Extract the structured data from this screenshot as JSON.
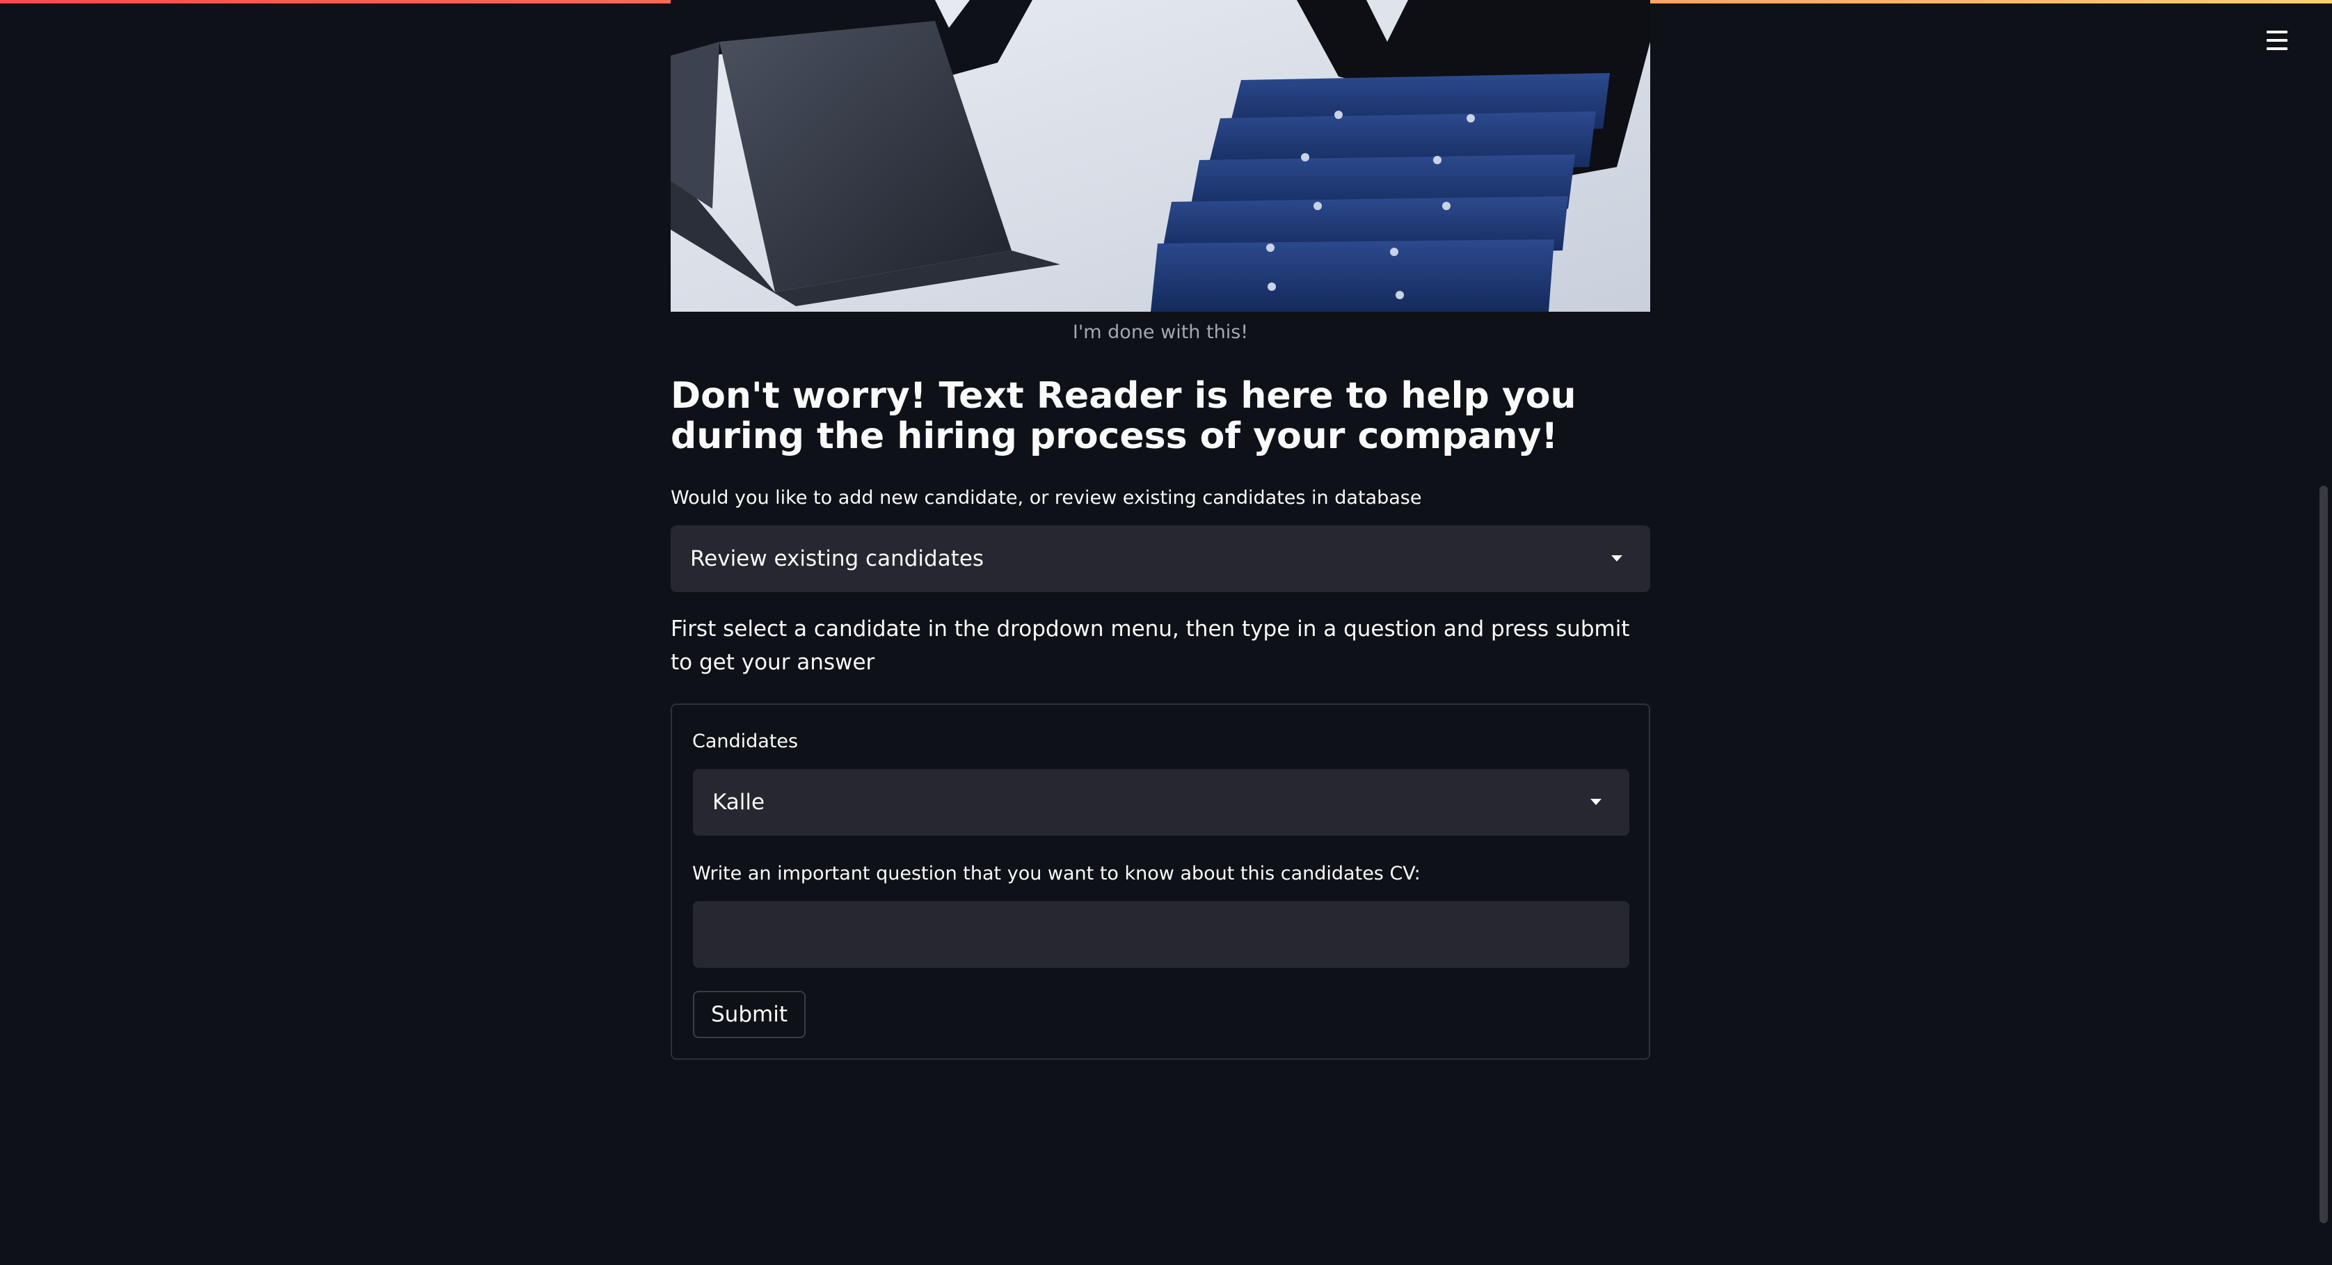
{
  "image": {
    "caption": "I'm done with this!"
  },
  "header": {
    "menu_icon": "hamburger-menu-icon"
  },
  "main": {
    "headline": "Don't worry! Text Reader is here to help you during the hiring process of your company!",
    "mode_question": "Would you like to add new candidate, or review existing candidates in database",
    "mode_select": {
      "selected": "Review existing candidates",
      "icon": "chevron-down-icon"
    },
    "instructions": "First select a candidate in the dropdown menu, then type in a question and press submit to get your answer"
  },
  "form": {
    "candidates_label": "Candidates",
    "candidate_select": {
      "selected": "Kalle",
      "icon": "chevron-down-icon"
    },
    "question_label": "Write an important question that you want to know about this candidates CV:",
    "question_value": "",
    "submit_label": "Submit"
  },
  "colors": {
    "background": "#0e1117",
    "input_background": "#262730",
    "text": "#fafafa",
    "caption": "#a3a8b4",
    "accent_gradient_start": "#ff4b4b",
    "accent_gradient_end": "#ffd16a"
  }
}
